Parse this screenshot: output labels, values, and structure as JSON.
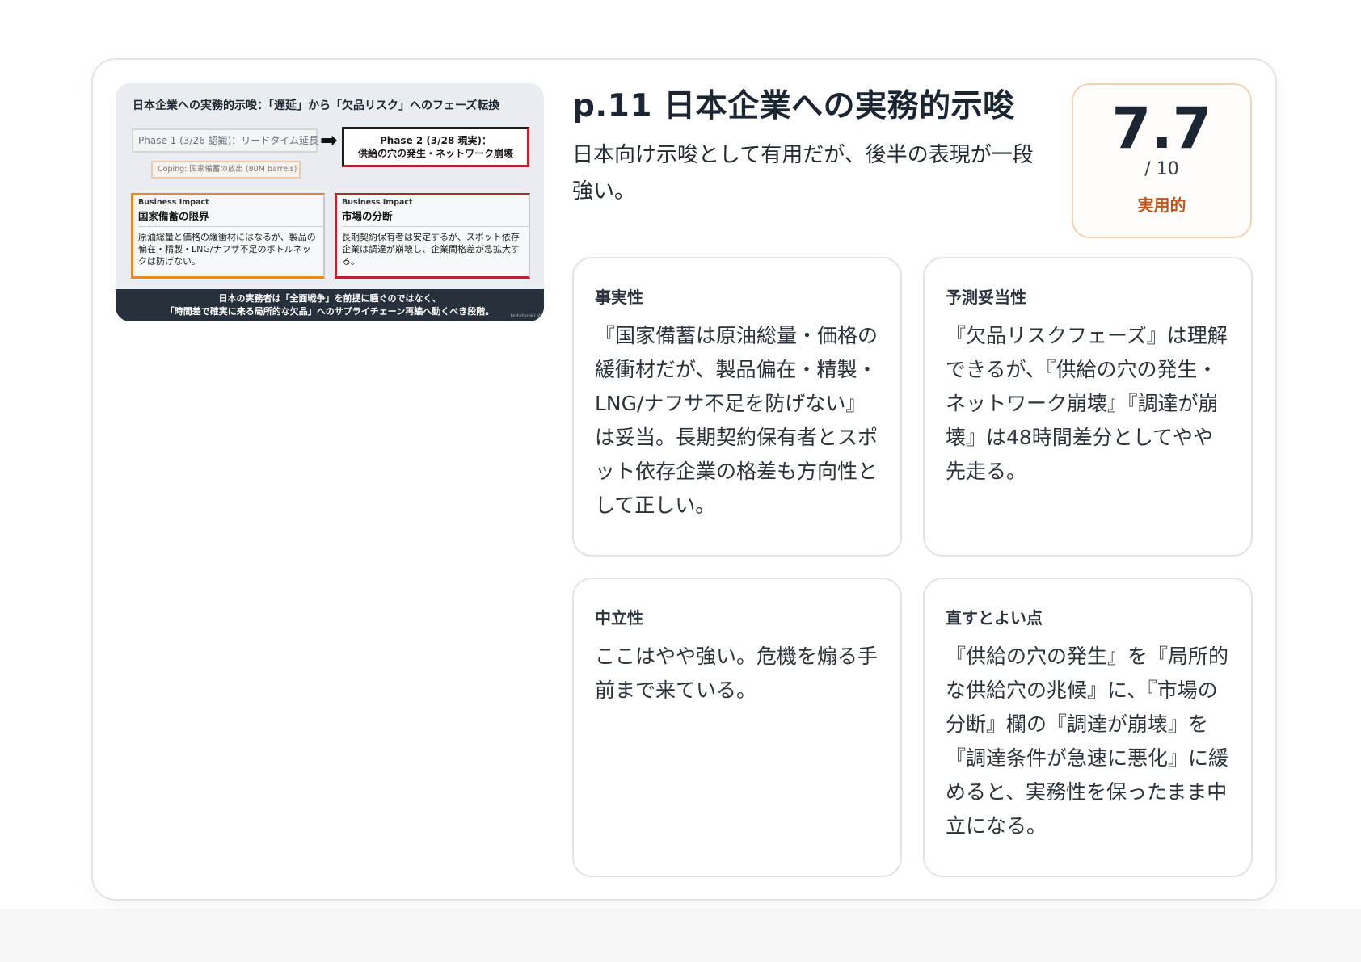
{
  "slide": {
    "title": "日本企業への実務的示唆：「遅延」から「欠品リスク」へのフェーズ転換",
    "phase1": "Phase 1 (3/26 認識)：リードタイム延長",
    "phase2_line1": "Phase 2 (3/28 現実)：",
    "phase2_line2": "供給の穴の発生・ネットワーク崩壊",
    "coping": "Coping: 国家備蓄の放出 (80M barrels)",
    "left_box": {
      "tag": "Business Impact",
      "heading": "国家備蓄の限界",
      "body": "原油総量と価格の緩衝材にはなるが、製品の偏在・精製・LNG/ナフサ不足のボトルネックは防げない。"
    },
    "right_box": {
      "tag": "Business Impact",
      "heading": "市場の分断",
      "body": "長期契約保有者は安定するが、スポット依存企業は調達が崩壊し、企業間格差が急拡大する。"
    },
    "footer_line1": "日本の実務者は「全面戦争」を前提に騒ぐのではなく、",
    "footer_line2": "「時間差で確実に来る局所的な欠品」へのサプライチェーン再編へ動くべき段階。",
    "credit": "NotebookLM"
  },
  "header": {
    "title": "p.11 日本企業への実務的示唆",
    "subtitle": "日本向け示唆として有用だが、後半の表現が一段強い。"
  },
  "score": {
    "value": "7.7",
    "max": "/ 10",
    "label": "実用的",
    "accent_color": "#c2541a"
  },
  "criteria": [
    {
      "heading": "事実性",
      "body": "『国家備蓄は原油総量・価格の緩衝材だが、製品偏在・精製・LNG/ナフサ不足を防げない』は妥当。長期契約保有者とスポット依存企業の格差も方向性として正しい。"
    },
    {
      "heading": "予測妥当性",
      "body": "『欠品リスクフェーズ』は理解できるが、『供給の穴の発生・ネットワーク崩壊』『調達が崩壊』は48時間差分としてやや先走る。"
    },
    {
      "heading": "中立性",
      "body": "ここはやや強い。危機を煽る手前まで来ている。"
    },
    {
      "heading": "直すとよい点",
      "body": "『供給の穴の発生』を『局所的な供給穴の兆候』に、『市場の分断』欄の『調達が崩壊』を『調達条件が急速に悪化』に緩めると、実務性を保ったまま中立になる。"
    }
  ]
}
